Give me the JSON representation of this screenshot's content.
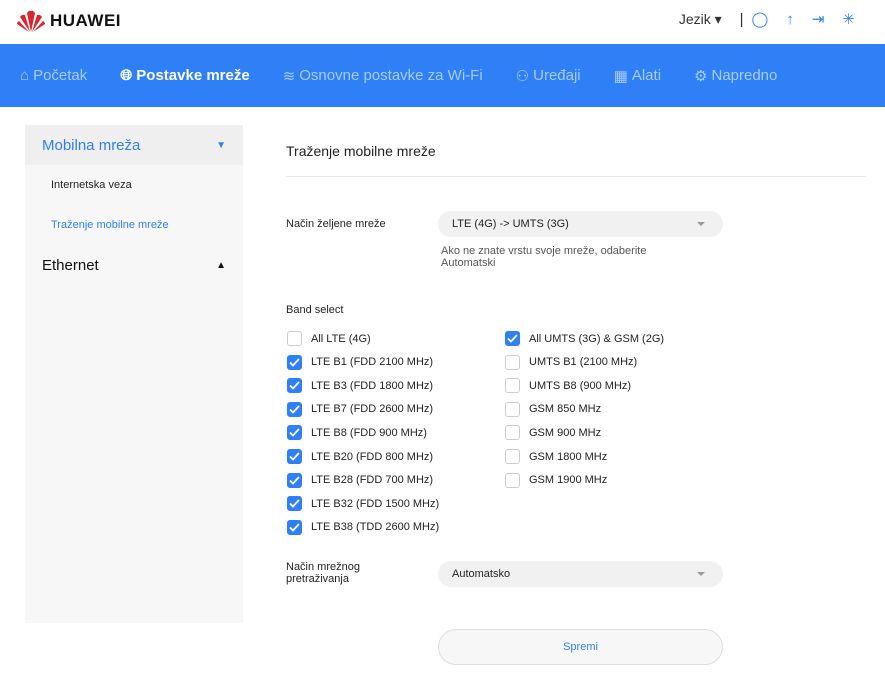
{
  "brand": "HUAWEI",
  "header": {
    "language": "Jezik"
  },
  "nav": [
    {
      "label": "Početak",
      "icon": "home-icon"
    },
    {
      "label": "Postavke mreže",
      "icon": "globe-icon",
      "active": true
    },
    {
      "label": "Osnovne postavke za Wi-Fi",
      "icon": "wifi-icon"
    },
    {
      "label": "Uređaji",
      "icon": "devices-icon"
    },
    {
      "label": "Alati",
      "icon": "tools-icon"
    },
    {
      "label": "Napredno",
      "icon": "gear-icon"
    }
  ],
  "sidebar": {
    "mobile": "Mobilna mreža",
    "internet": "Internetska veza",
    "search": "Traženje mobilne mreže",
    "ethernet": "Ethernet"
  },
  "page": {
    "title": "Traženje mobilne mreže",
    "pref_label": "Način željene mreže",
    "pref_value": "LTE (4G) -> UMTS (3G)",
    "hint": "Ako ne znate vrstu svoje mreže, odaberite Automatski",
    "band_label": "Band select",
    "search_label": "Način mrežnog pretraživanja",
    "search_value": "Automatsko",
    "save": "Spremi"
  },
  "bands_left": [
    {
      "label": "All LTE (4G)",
      "checked": false
    },
    {
      "label": "LTE B1 (FDD 2100 MHz)",
      "checked": true
    },
    {
      "label": "LTE B3 (FDD 1800 MHz)",
      "checked": true
    },
    {
      "label": "LTE B7 (FDD 2600 MHz)",
      "checked": true
    },
    {
      "label": "LTE B8 (FDD 900 MHz)",
      "checked": true
    },
    {
      "label": "LTE B20 (FDD 800 MHz)",
      "checked": true
    },
    {
      "label": "LTE B28 (FDD 700 MHz)",
      "checked": true
    },
    {
      "label": "LTE B32 (FDD 1500 MHz)",
      "checked": true
    },
    {
      "label": "LTE B38 (TDD 2600 MHz)",
      "checked": true
    }
  ],
  "bands_right": [
    {
      "label": "All UMTS (3G) & GSM (2G)",
      "checked": true
    },
    {
      "label": "UMTS B1 (2100 MHz)",
      "checked": false
    },
    {
      "label": "UMTS B8 (900 MHz)",
      "checked": false
    },
    {
      "label": "GSM 850 MHz",
      "checked": false
    },
    {
      "label": "GSM 900 MHz",
      "checked": false
    },
    {
      "label": "GSM 1800 MHz",
      "checked": false
    },
    {
      "label": "GSM 1900 MHz",
      "checked": false
    }
  ]
}
